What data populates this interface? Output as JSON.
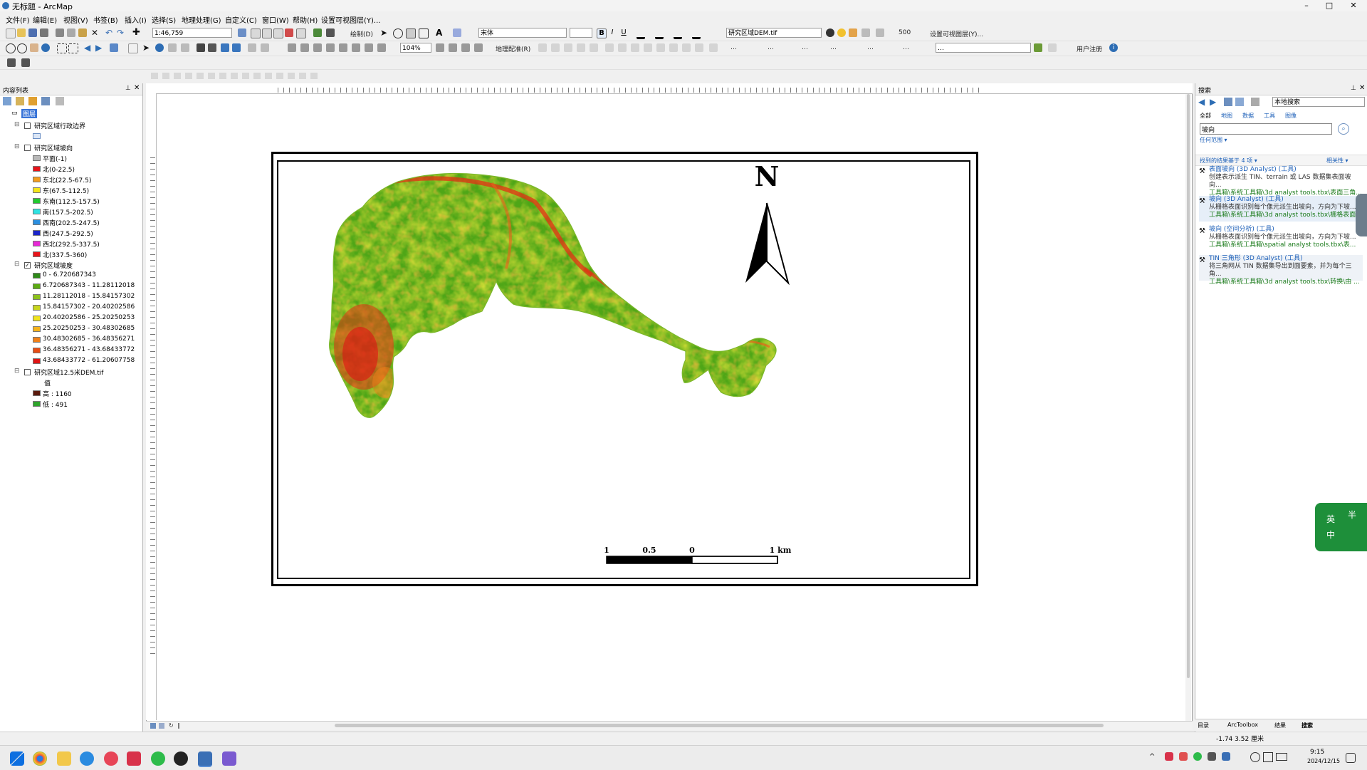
{
  "window": {
    "title": "无标题 - ArcMap",
    "minimize": "–",
    "maximize": "□",
    "close": "✕"
  },
  "menu": [
    "文件(F)",
    "编辑(E)",
    "视图(V)",
    "书签(B)",
    "插入(I)",
    "选择(S)",
    "地理处理(G)",
    "自定义(C)",
    "窗口(W)",
    "帮助(H)",
    "设置可视图层(Y)..."
  ],
  "toolbar": {
    "scale": "1:46,759",
    "drawing_label": "绘制(D)",
    "font": "宋体",
    "font_size": "",
    "layer_combo": "研究区域DEM.tif",
    "zoom_percent": "104%",
    "georef_label": "地理配准(R)",
    "bold": "B",
    "italic": "I",
    "underline": "U",
    "labels_right": [
      "…",
      "…",
      "…",
      "…",
      "…",
      "…",
      "…",
      "用户注册"
    ],
    "value_500": "500",
    "row3_label": "…"
  },
  "toc": {
    "title": "内容列表",
    "layers_root": "图层",
    "groups": [
      {
        "name": "研究区域行政边界",
        "checked": false,
        "items": []
      },
      {
        "name": "研究区域坡向",
        "checked": false,
        "items": [
          {
            "label": "平面(-1)",
            "color": "#b8b8b8"
          },
          {
            "label": "北(0-22.5)",
            "color": "#e8141a"
          },
          {
            "label": "东北(22.5-67.5)",
            "color": "#f39c1e"
          },
          {
            "label": "东(67.5-112.5)",
            "color": "#f4e51a"
          },
          {
            "label": "东南(112.5-157.5)",
            "color": "#23c92e"
          },
          {
            "label": "南(157.5-202.5)",
            "color": "#2ee3e3"
          },
          {
            "label": "西南(202.5-247.5)",
            "color": "#2a8fe0"
          },
          {
            "label": "西(247.5-292.5)",
            "color": "#1b25c8"
          },
          {
            "label": "西北(292.5-337.5)",
            "color": "#e828d6"
          },
          {
            "label": "北(337.5-360)",
            "color": "#e8141a"
          }
        ]
      },
      {
        "name": "研究区域坡度",
        "checked": true,
        "items": [
          {
            "label": "0 - 6.720687343",
            "color": "#2e8a19"
          },
          {
            "label": "6.720687343 - 11.28112018",
            "color": "#5cab12"
          },
          {
            "label": "11.28112018 - 15.84157302",
            "color": "#8cc21a"
          },
          {
            "label": "15.84157302 - 20.40202586",
            "color": "#c8d61c"
          },
          {
            "label": "20.40202586 - 25.20250253",
            "color": "#f0e41c"
          },
          {
            "label": "25.20250253 - 30.48302685",
            "color": "#f5b31a"
          },
          {
            "label": "30.48302685 - 36.48356271",
            "color": "#f08018"
          },
          {
            "label": "36.48356271 - 43.68433772",
            "color": "#e84c14"
          },
          {
            "label": "43.68433772 - 61.20607758",
            "color": "#e01414"
          }
        ]
      },
      {
        "name": "研究区域12.5米DEM.tif",
        "checked": false,
        "items": [
          {
            "label": "值",
            "color": ""
          },
          {
            "label": "高 : 1160",
            "color": "#5a1a0c"
          },
          {
            "label": "低 : 491",
            "color": "#2fa52c"
          }
        ]
      }
    ]
  },
  "map": {
    "north_letter": "N",
    "scale_labels": [
      "1",
      "0.5",
      "0",
      "1 km"
    ]
  },
  "search": {
    "title": "搜索",
    "scope": "本地搜索",
    "tabs": [
      "全部",
      "地图",
      "数据",
      "工具",
      "图像"
    ],
    "query": "坡向",
    "hint": "任何范围 ▾",
    "results_header": "找到的结果基于 4 项 ▾",
    "sort": "相关性 ▾",
    "results": [
      {
        "title": "表面坡向 (3D Analyst) (工具)",
        "desc": "创建表示派生 TIN、terrain 或 LAS 数据集表面坡向...",
        "path": "工具箱\\系统工具箱\\3d analyst tools.tbx\\表面三角..."
      },
      {
        "title": "坡向 (3D Analyst) (工具)",
        "desc": "从栅格表面识别每个像元派生出坡向，方向为下坡...",
        "path": "工具箱\\系统工具箱\\3d analyst tools.tbx\\栅格表面..."
      },
      {
        "title": "坡向 (空间分析) (工具)",
        "desc": "从栅格表面识别每个像元派生出坡向，方向为下坡...",
        "path": "工具箱\\系统工具箱\\spatial analyst tools.tbx\\表..."
      },
      {
        "title": "TIN 三角形 (3D Analyst) (工具)",
        "desc": "将三角网从 TIN 数据集导出到面要素，并为每个三角...",
        "path": "工具箱\\系统工具箱\\3d analyst tools.tbx\\转换\\由 ..."
      }
    ],
    "bottom_tabs": [
      "目录",
      "ArcToolbox",
      "结果",
      "搜索"
    ]
  },
  "widget": {
    "chars": [
      "英",
      "中",
      "半"
    ]
  },
  "status": {
    "coords": "-1.74  3.52 厘米"
  },
  "taskbar": {
    "time": "9:15",
    "date": "2024/12/15"
  }
}
